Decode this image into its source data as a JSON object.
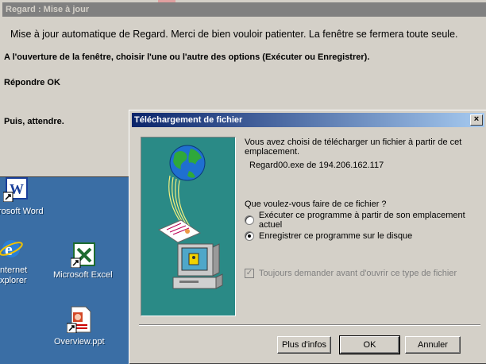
{
  "background_window": {
    "title": "Regard : Mise à jour",
    "message": "Mise à jour automatique de Regard. Merci de bien vouloir patienter. La fenêtre se fermera toute seule.",
    "instruction": "A l'ouverture de la fenêtre, choisir l'une ou l'autre des options (Exécuter ou Enregistrer).",
    "step_ok": "Répondre OK",
    "step_wait": "Puis, attendre."
  },
  "desktop": {
    "icons": [
      {
        "label": "rosoft Word",
        "icon": "word-icon"
      },
      {
        "label": "nternet\nxplorer",
        "icon": "internet-explorer-icon"
      },
      {
        "label": "Microsoft Excel",
        "icon": "excel-icon"
      },
      {
        "label": "Overview.ppt",
        "icon": "powerpoint-icon"
      }
    ]
  },
  "dialog": {
    "title": "Téléchargement de fichier",
    "intro": "Vous avez choisi de télécharger un fichier à partir de cet emplacement.",
    "file_source": "Regard00.exe de 194.206.162.117",
    "question": "Que voulez-vous faire de ce fichier ?",
    "options": [
      {
        "label": "Exécuter ce programme à partir de son emplacement actuel",
        "selected": false
      },
      {
        "label": "Enregistrer ce programme sur le disque",
        "selected": true
      }
    ],
    "always_ask": {
      "label": "Toujours demander avant d'ouvrir ce type de fichier",
      "checked": true,
      "enabled": false
    },
    "buttons": {
      "more_info": "Plus d'infos",
      "ok": "OK",
      "cancel": "Annuler"
    },
    "close_glyph": "×"
  },
  "colors": {
    "desktop": "#3a6ea5",
    "title_active_start": "#0a246a",
    "title_active_end": "#a6caf0",
    "title_inactive": "#808080",
    "face": "#d4d0c8",
    "illustration_bg": "#2a8a86"
  }
}
